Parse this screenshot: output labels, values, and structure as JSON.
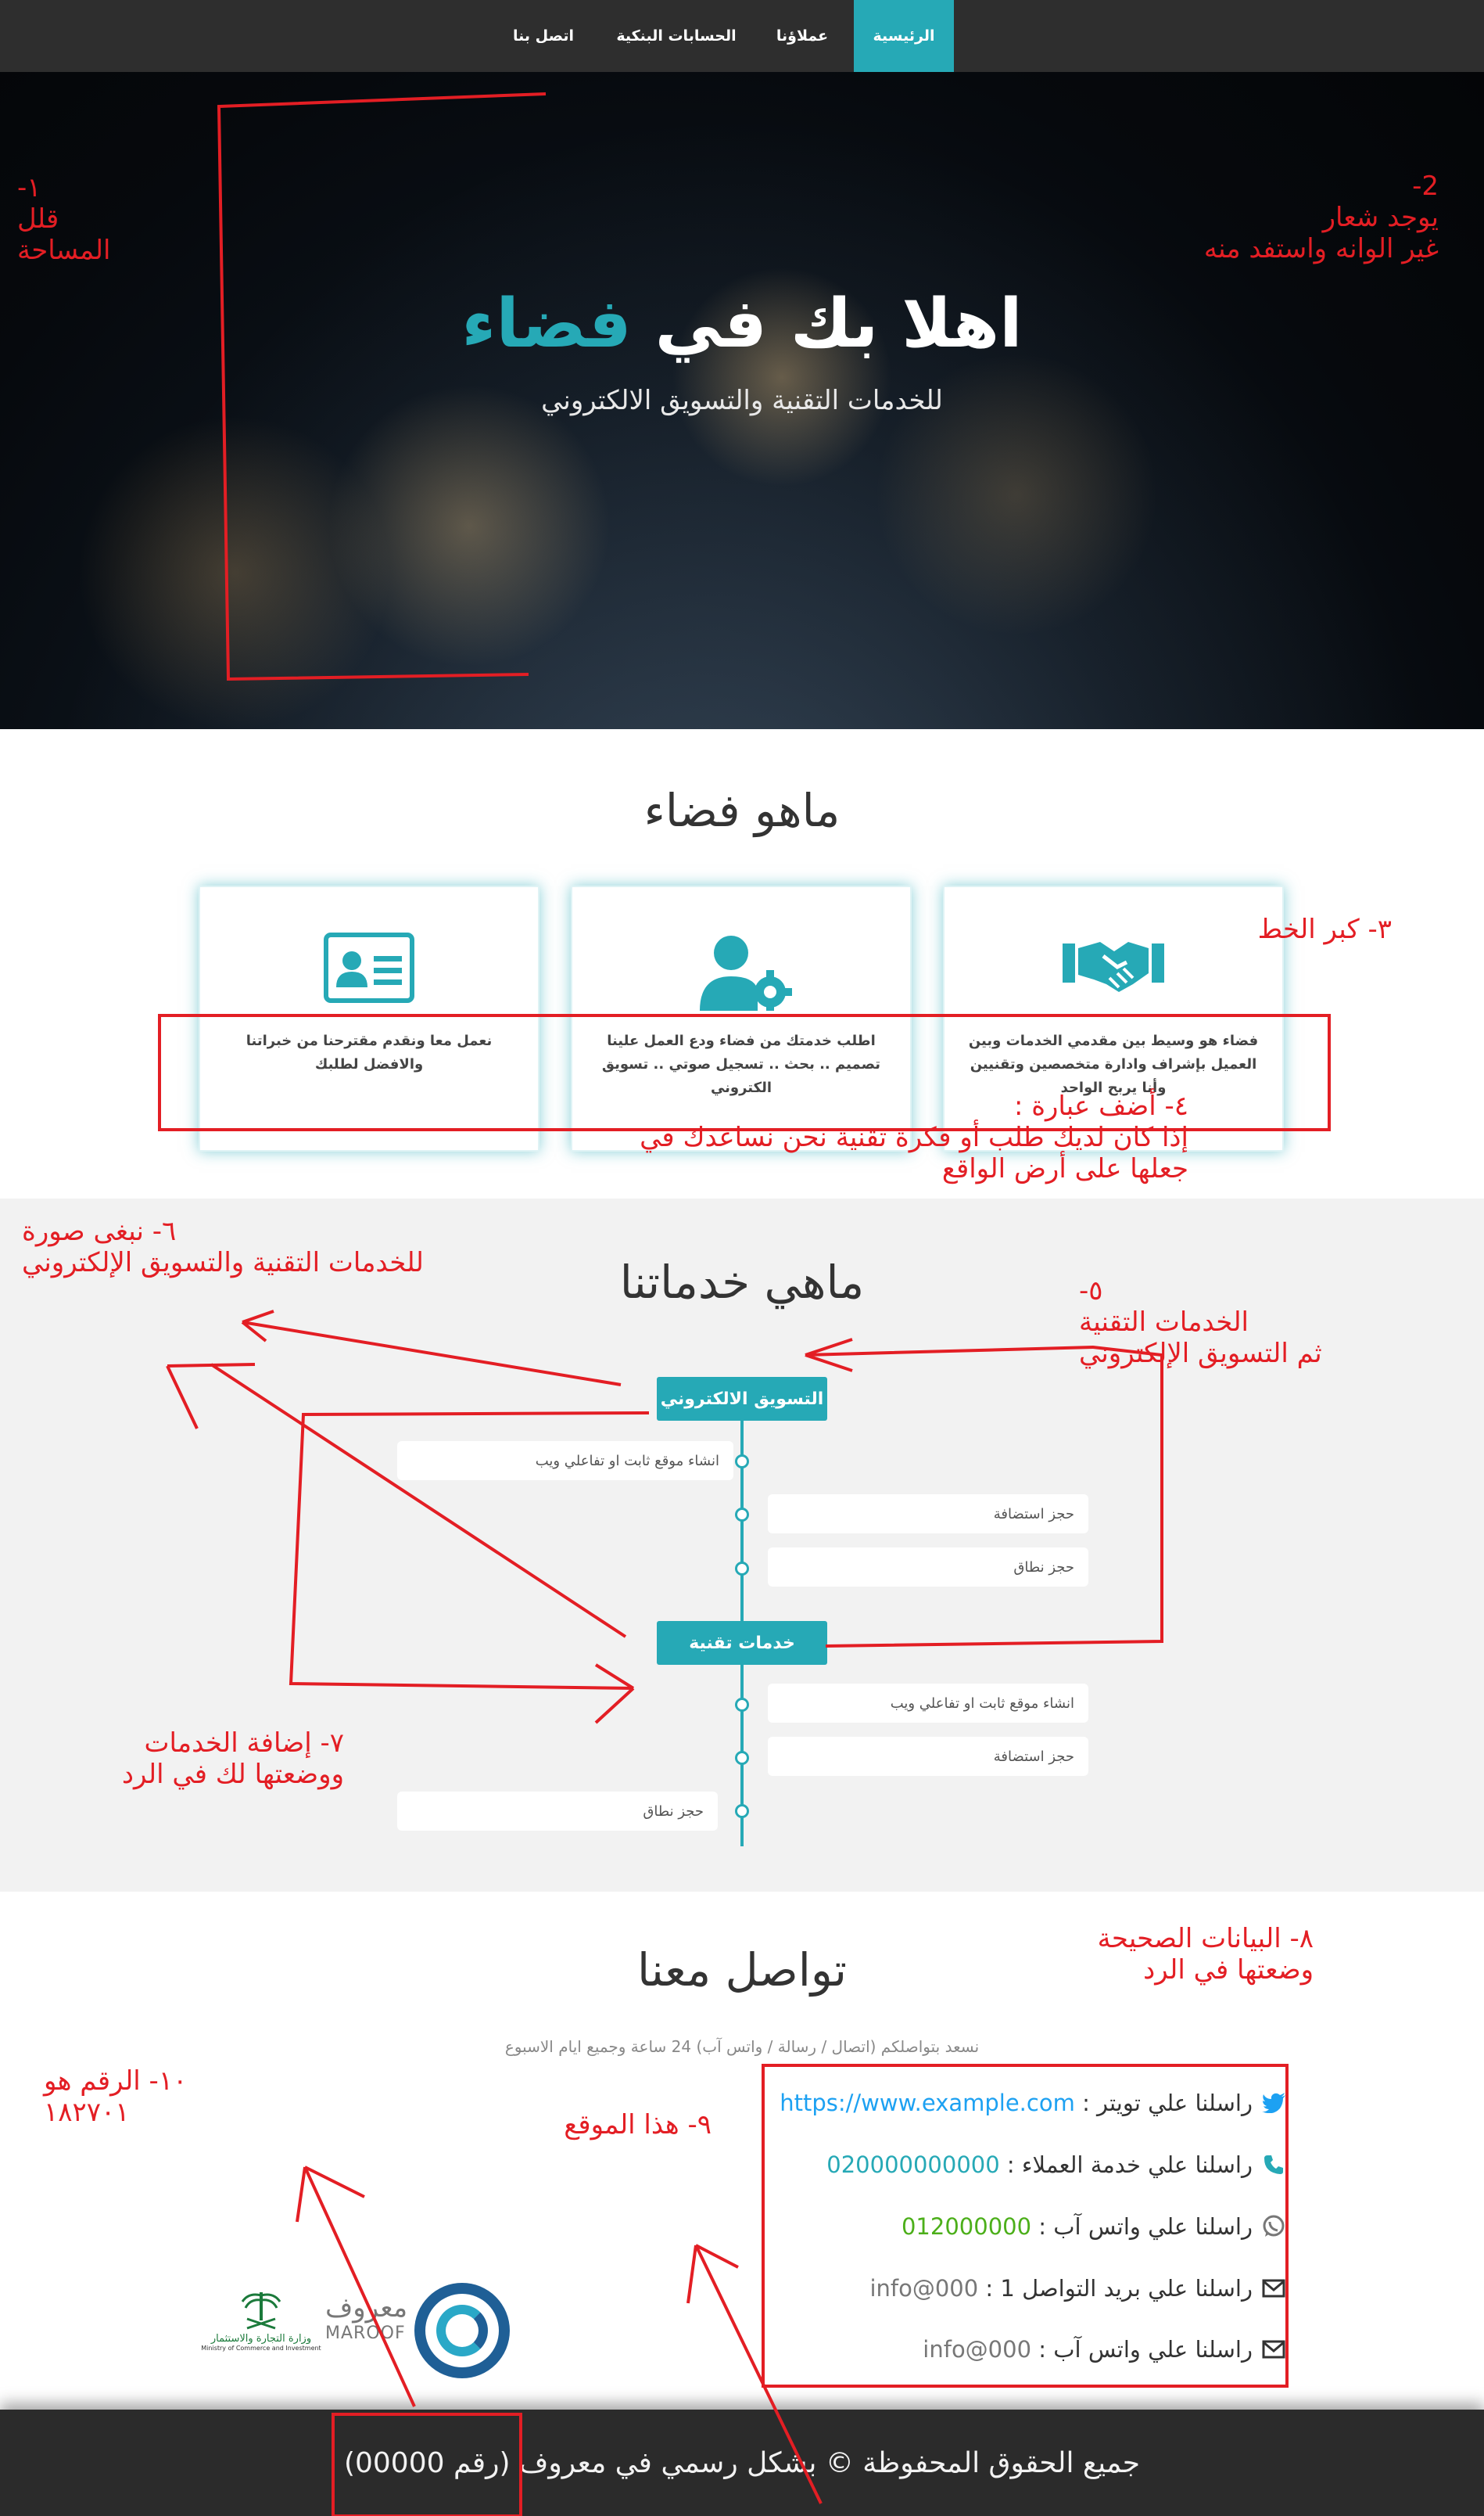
{
  "nav": {
    "items": [
      {
        "label": "الرئيسية",
        "active": true
      },
      {
        "label": "عملاؤنا",
        "active": false
      },
      {
        "label": "الحسابات البنكية",
        "active": false
      },
      {
        "label": "اتصل بنا",
        "active": false
      }
    ]
  },
  "hero": {
    "title_main": "اهلا بك في",
    "title_accent": "فضاء",
    "subtitle": "للخدمات التقنية والتسويق الالكتروني"
  },
  "about": {
    "title": "ماهو فضاء",
    "cards": [
      {
        "icon": "handshake-icon",
        "text": "فضاء هو وسيط بين مقدمي الخدمات وبين العميل بإشراف وادارة متخصصين وتقنيين وأنا يربح الواحد"
      },
      {
        "icon": "user-gear-icon",
        "text": "اطلب خدمتك من فضاء ودع العمل علينا تصميم .. بحث .. تسجيل صوتي .. تسويق الكتروني"
      },
      {
        "icon": "id-card-icon",
        "text": "نعمل معا ونقدم مقترحنا من خبراتنا والافضل لطلبك"
      }
    ]
  },
  "services": {
    "title": "ماهي خدماتنا",
    "groups": [
      {
        "title": "التسويق الالكتروني",
        "items": [
          "انشاء موقع ثابت او تفاعلي ويب",
          "حجز استضافة",
          "حجز نطاق"
        ]
      },
      {
        "title": "خدمات تقنية",
        "items": [
          "انشاء موقع ثابت او تفاعلي ويب",
          "حجز استضافة",
          "حجز نطاق"
        ]
      }
    ]
  },
  "contact": {
    "title": "تواصل معنا",
    "subtitle": "نسعد بتواصلكم (اتصال / رسالة / واتس آب) 24 ساعة وجميع ايام الاسبوع",
    "rows": [
      {
        "icon": "twitter-icon",
        "label": "راسلنا علي تويتر :",
        "value": "https://www.example.com"
      },
      {
        "icon": "phone-icon",
        "label": "راسلنا علي خدمة العملاء :",
        "value": "020000000000"
      },
      {
        "icon": "whatsapp-icon",
        "label": "راسلنا علي واتس آب :",
        "value": "012000000"
      },
      {
        "icon": "envelope-icon",
        "label": "راسلنا علي بريد التواصل 1 :",
        "value": "info@000"
      },
      {
        "icon": "envelope-icon",
        "label": "راسلنا علي واتس آب :",
        "value": "info@000"
      }
    ],
    "logos": {
      "maroof_ar": "معروف",
      "maroof_en": "MAROOF",
      "ministry_ar": "وزارة التجارة والاستثمار",
      "ministry_en": "Ministry of Commerce and Investment"
    }
  },
  "footer": {
    "text": "جميع الحقوق المحفوظة © بشكل رسمي في معروف (رقم 00000)"
  },
  "annotations": {
    "a1": "١-\nقلل\nالمساحة",
    "a2": "2-\nيوجد شعار\nغير الوانه واستفد منه",
    "a3": "٣- كبر الخط",
    "a4": "٤- أضف عبارة :\nإذا كان لديك طلب أو فكرة تقنية نحن نساعدك في\nجعلها على أرض الواقع",
    "a5": "٥-\nالخدمات التقنية\nثم التسويق الإلكتروني",
    "a6": "٦- نبغى صورة\nللخدمات التقنية والتسويق الإلكتروني",
    "a7": "٧- إضافة الخدمات\nووضعتها لك في الرد",
    "a8": "٨- البيانات الصحيحة\nوضعتها في الرد",
    "a9": "٩- هذا الموقع",
    "a10": "١٠- الرقم هو\n١٨٢٧٠١"
  },
  "colors": {
    "accent": "#26a9b6",
    "nav_bg": "#2e2e2e",
    "annotation": "#e31e24",
    "footer_bg": "#2b2b2b"
  }
}
